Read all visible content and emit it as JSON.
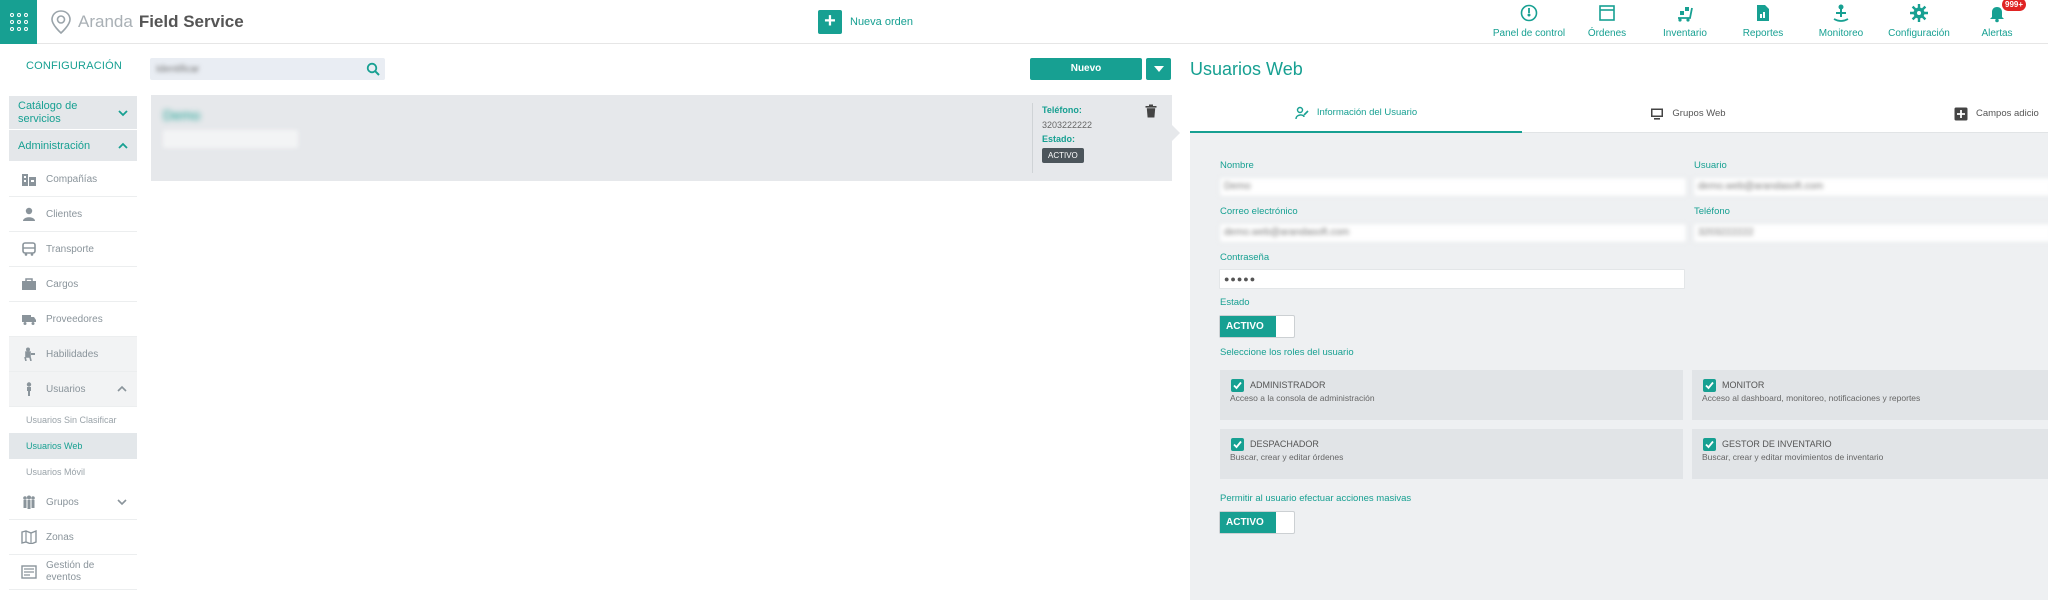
{
  "app": {
    "brand_light": "Aranda",
    "brand_bold": "Field Service",
    "accent": "#17a092"
  },
  "toolbar": {
    "new_order": "Nueva orden"
  },
  "topnav": [
    {
      "label": "Panel de control",
      "icon": "dashboard-icon"
    },
    {
      "label": "Órdenes",
      "icon": "orders-icon"
    },
    {
      "label": "Inventario",
      "icon": "inventory-icon"
    },
    {
      "label": "Reportes",
      "icon": "reports-icon"
    },
    {
      "label": "Monitoreo",
      "icon": "monitoring-icon"
    },
    {
      "label": "Configuración",
      "icon": "gear-icon"
    },
    {
      "label": "Alertas",
      "icon": "bell-icon",
      "badge": "999+"
    }
  ],
  "sidebar": {
    "title": "CONFIGURACIÓN",
    "sections": {
      "catalog": "Catálogo de servicios",
      "admin": "Administración"
    },
    "items": [
      {
        "label": "Compañías",
        "icon": "building-icon"
      },
      {
        "label": "Clientes",
        "icon": "person-icon"
      },
      {
        "label": "Transporte",
        "icon": "bus-icon"
      },
      {
        "label": "Cargos",
        "icon": "briefcase-icon"
      },
      {
        "label": "Proveedores",
        "icon": "truck-icon"
      },
      {
        "label": "Habilidades",
        "icon": "skills-icon"
      },
      {
        "label": "Usuarios",
        "icon": "user-icon"
      }
    ],
    "sub_items": [
      "Usuarios Sin Clasificar",
      "Usuarios Web",
      "Usuarios Móvil"
    ],
    "items_after": [
      {
        "label": "Grupos",
        "icon": "group-icon"
      },
      {
        "label": "Zonas",
        "icon": "map-icon"
      },
      {
        "label": "Gestión de eventos",
        "icon": "events-icon"
      }
    ]
  },
  "list": {
    "search_placeholder": "Identificar",
    "new_button": "Nuevo",
    "card": {
      "name": "Demo",
      "subtitle": "demo@arandasoft.com",
      "phone_label": "Teléfono:",
      "phone_value": "3203222222",
      "status_label": "Estado:",
      "status_value": "ACTIVO"
    }
  },
  "detail": {
    "title": "Usuarios Web",
    "tabs": [
      {
        "label": "Información del Usuario",
        "icon": "user-edit-icon"
      },
      {
        "label": "Grupos Web",
        "icon": "monitor-icon"
      },
      {
        "label": "Campos adicio",
        "icon": "plus-square-icon"
      }
    ],
    "fields": {
      "name_label": "Nombre",
      "name_value": "Demo",
      "user_label": "Usuario",
      "user_value": "demo.web@arandasoft.com",
      "email_label": "Correo electrónico",
      "email_value": "demo.web@arandasoft.com",
      "phone_label": "Teléfono",
      "phone_value": "3203222222",
      "password_label": "Contraseña",
      "password_value": "●●●●●",
      "status_label": "Estado",
      "status_value": "ACTIVO"
    },
    "roles_label": "Seleccione los roles del usuario",
    "roles": [
      {
        "name": "ADMINISTRADOR",
        "desc": "Acceso a la consola de administración"
      },
      {
        "name": "MONITOR",
        "desc": "Acceso al dashboard, monitoreo, notificaciones y reportes"
      },
      {
        "name": "DESPACHADOR",
        "desc": "Buscar, crear y editar órdenes"
      },
      {
        "name": "GESTOR DE INVENTARIO",
        "desc": "Buscar, crear y editar movimientos de inventario"
      }
    ],
    "mass_label": "Permitir al usuario efectuar acciones masivas",
    "mass_value": "ACTIVO"
  }
}
